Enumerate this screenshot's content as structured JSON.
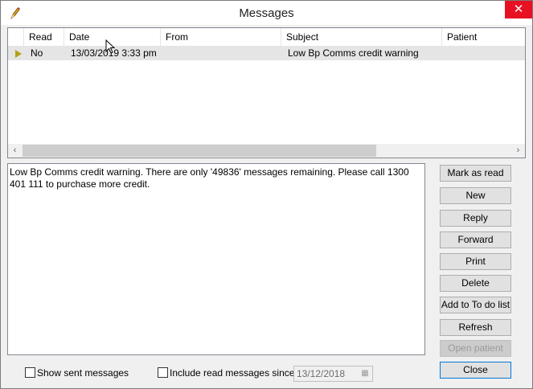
{
  "window": {
    "title": "Messages",
    "close_glyph": "✕",
    "icon": "pencil-icon"
  },
  "list": {
    "columns": [
      "Read",
      "Date",
      "From",
      "Subject",
      "Patient"
    ],
    "rows": [
      {
        "read": "No",
        "date": "13/03/2019 3:33 pm",
        "from": "",
        "subject": "Low Bp Comms credit warning",
        "patient": ""
      }
    ],
    "scroll_left_glyph": "‹",
    "scroll_right_glyph": "›"
  },
  "message_body": "Low Bp Comms credit warning. There are only '49836' messages remaining. Please call 1300 401 111 to purchase more credit.",
  "buttons": {
    "mark_as_read": "Mark as read",
    "new": "New",
    "reply": "Reply",
    "forward": "Forward",
    "print": "Print",
    "delete": "Delete",
    "add_to_do": "Add to To do list",
    "refresh": "Refresh",
    "open_patient": "Open patient",
    "close": "Close"
  },
  "filters": {
    "show_sent_label": "Show sent messages",
    "show_sent_checked": false,
    "include_read_label": "Include read messages since",
    "include_read_checked": false,
    "since_date": "13/12/2018",
    "calendar_glyph": "▦"
  },
  "colors": {
    "close_button": "#e81123",
    "selected_row": "#e5e5e5",
    "row_arrow": "#b5a11a"
  }
}
